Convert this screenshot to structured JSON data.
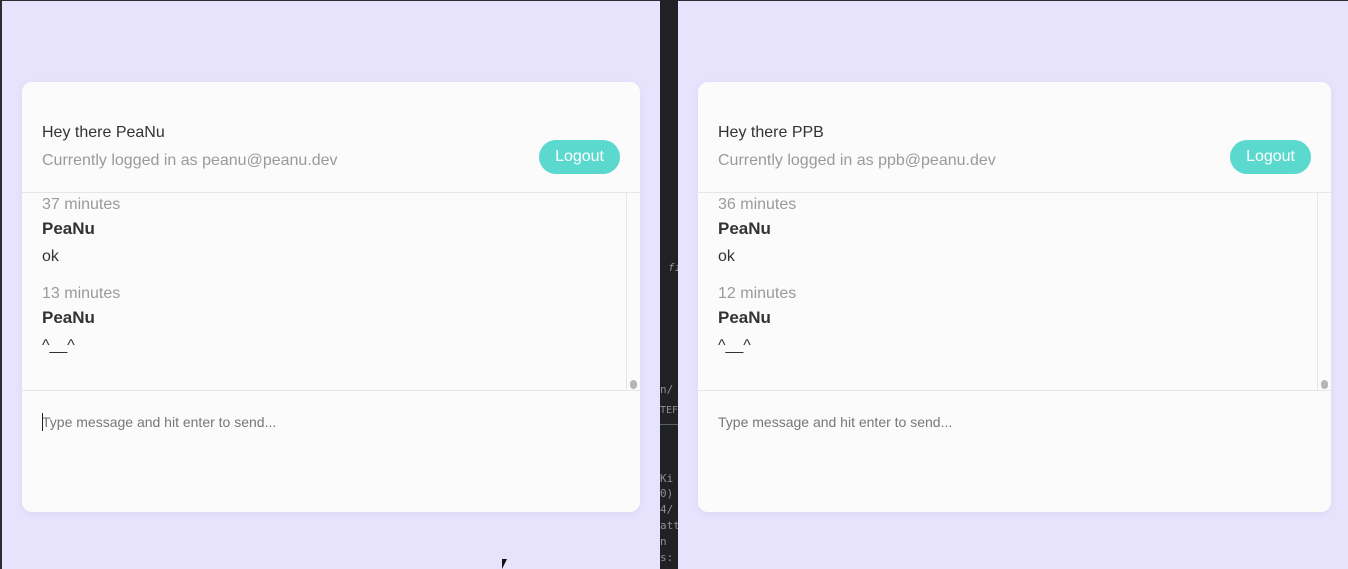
{
  "left_window": {
    "greeting": "Hey there PeaNu",
    "login_info": "Currently logged in as peanu@peanu.dev",
    "logout_label": "Logout",
    "messages": [
      {
        "time": "37 minutes",
        "author": "PeaNu",
        "text": "ok"
      },
      {
        "time": "13 minutes",
        "author": "PeaNu",
        "text": "^__^"
      }
    ],
    "composer_placeholder": "Type message and hit enter to send..."
  },
  "right_window": {
    "greeting": "Hey there PPB",
    "login_info": "Currently logged in as ppb@peanu.dev",
    "logout_label": "Logout",
    "messages": [
      {
        "time": "36 minutes",
        "author": "PeaNu",
        "text": "ok"
      },
      {
        "time": "12 minutes",
        "author": "PeaNu",
        "text": "^__^"
      }
    ],
    "composer_placeholder": "Type message and hit enter to send..."
  },
  "terminal_fragments": [
    "fi",
    "n/",
    "TEF",
    "Ki",
    "0)",
    "4/",
    "att",
    "n",
    "s:"
  ],
  "colors": {
    "background": "#e8e3fd",
    "card": "#fbfbfb",
    "accent": "#5bd9cf",
    "muted_text": "#9a9a9a",
    "primary_text": "#333333"
  },
  "icons": {
    "mouse_cursor": "arrow-cursor-icon"
  }
}
